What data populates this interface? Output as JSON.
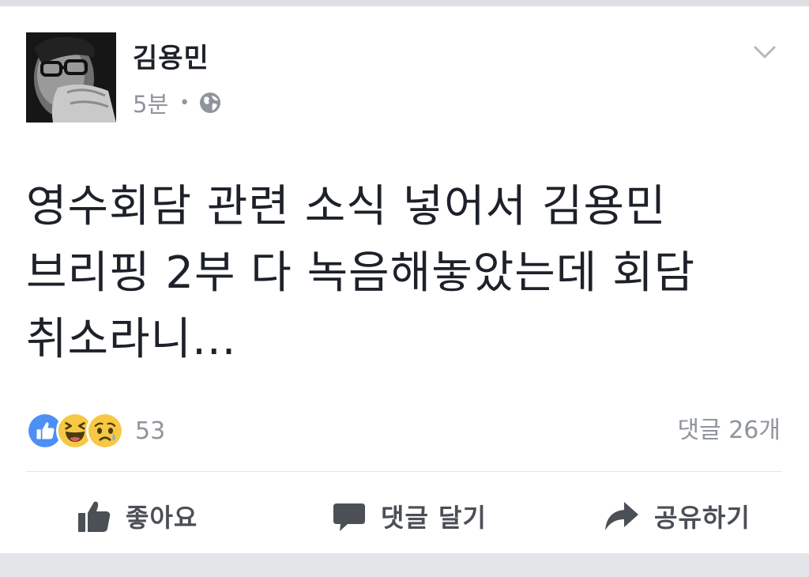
{
  "post": {
    "author": "김용민",
    "time": "5분",
    "separator": "•",
    "privacy_icon": "globe-icon",
    "menu_icon": "chevron-down-icon",
    "text_lines": [
      "영수회담 관련 소식 넣어서 김용민",
      "브리핑 2부 다 녹음해놓았는데 회담",
      "취소라니..."
    ]
  },
  "reactions": {
    "icons": [
      "like-reaction-icon",
      "haha-reaction-icon",
      "sad-reaction-icon"
    ],
    "count": "53"
  },
  "comments": {
    "count_label": "댓글 26개"
  },
  "actions": {
    "like_label": "좋아요",
    "comment_label": "댓글 달기",
    "share_label": "공유하기"
  },
  "colors": {
    "like_blue": "#4c8ff5",
    "emoji_yellow": "#f7c843",
    "text_dark": "#1d2129",
    "text_muted": "#90949c",
    "action_gray": "#4b4f56"
  }
}
